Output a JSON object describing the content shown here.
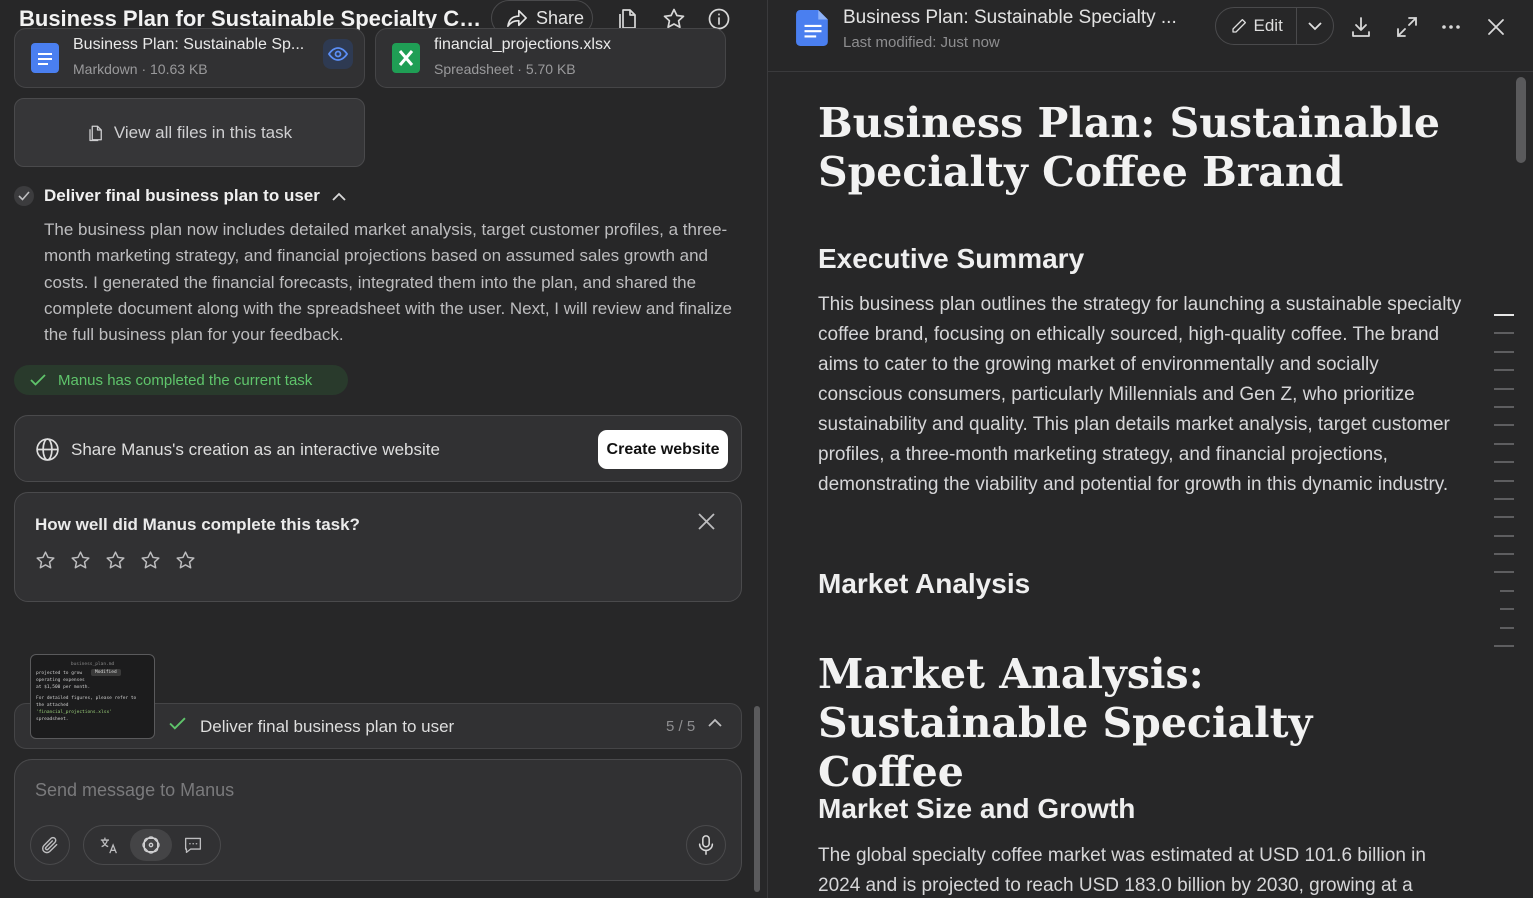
{
  "left": {
    "task_title": "Business Plan for Sustainable Specialty Coff...",
    "share_label": "Share",
    "files": [
      {
        "name": "Business Plan: Sustainable Sp...",
        "meta": "Markdown · 10.63 KB",
        "icon": "doc-icon"
      },
      {
        "name": "financial_projections.xlsx",
        "meta": "Spreadsheet · 5.70 KB",
        "icon": "excel-icon"
      }
    ],
    "view_all_label": "View all files in this task",
    "step": {
      "title": "Deliver final business plan to user",
      "description": "The business plan now includes detailed market analysis, target customer profiles, a three-month marketing strategy, and financial projections based on assumed sales growth and costs. I generated the financial forecasts, integrated them into the plan, and shared the complete document along with the spreadsheet with the user. Next, I will review and finalize the full business plan for your feedback."
    },
    "completed_label": "Manus has completed the current task",
    "share_website": {
      "text": "Share Manus's creation as an interactive website",
      "button": "Create website"
    },
    "rating": {
      "question": "How well did Manus complete this task?",
      "stars": 5,
      "value": 0
    },
    "thumbnail": {
      "title": "business_plan.md",
      "tag": "Modified",
      "lines": [
        "projected to grow",
        "operating expenses",
        "at $1,500 per month.",
        "",
        "For detailed figures, please refer to",
        "the attached",
        "'financial_projections.xlsx'",
        "spreadsheet."
      ]
    },
    "progress": {
      "label": "Deliver final business plan to user",
      "count": "5 / 5"
    },
    "composer": {
      "placeholder": "Send message to Manus"
    }
  },
  "right": {
    "title": "Business Plan: Sustainable Specialty ...",
    "subtitle": "Last modified: Just now",
    "edit_label": "Edit",
    "doc": {
      "h1_a": "Business Plan: Sustainable Specialty Coffee Brand",
      "h2_a": "Executive Summary",
      "p_a": "This business plan outlines the strategy for launching a sustainable specialty coffee brand, focusing on ethically sourced, high-quality coffee. The brand aims to cater to the growing market of environmentally and socially conscious consumers, particularly Millennials and Gen Z, who prioritize sustainability and quality. This plan details market analysis, target customer profiles, a three-month marketing strategy, and financial projections, demonstrating the viability and potential for growth in this dynamic industry.",
      "h2_b": "Market Analysis",
      "h1_b": "Market Analysis: Sustainable Specialty Coffee",
      "h2_c": "Market Size and Growth",
      "p_b": "The global specialty coffee market was estimated at USD 101.6 billion in 2024 and is projected to reach USD 183.0 billion by 2030, growing at a"
    }
  },
  "colors": {
    "background": "#272728",
    "card": "#313133",
    "success": "#5fc46b",
    "doc_blue": "#4a7ff0",
    "excel_green": "#1f9e55"
  }
}
